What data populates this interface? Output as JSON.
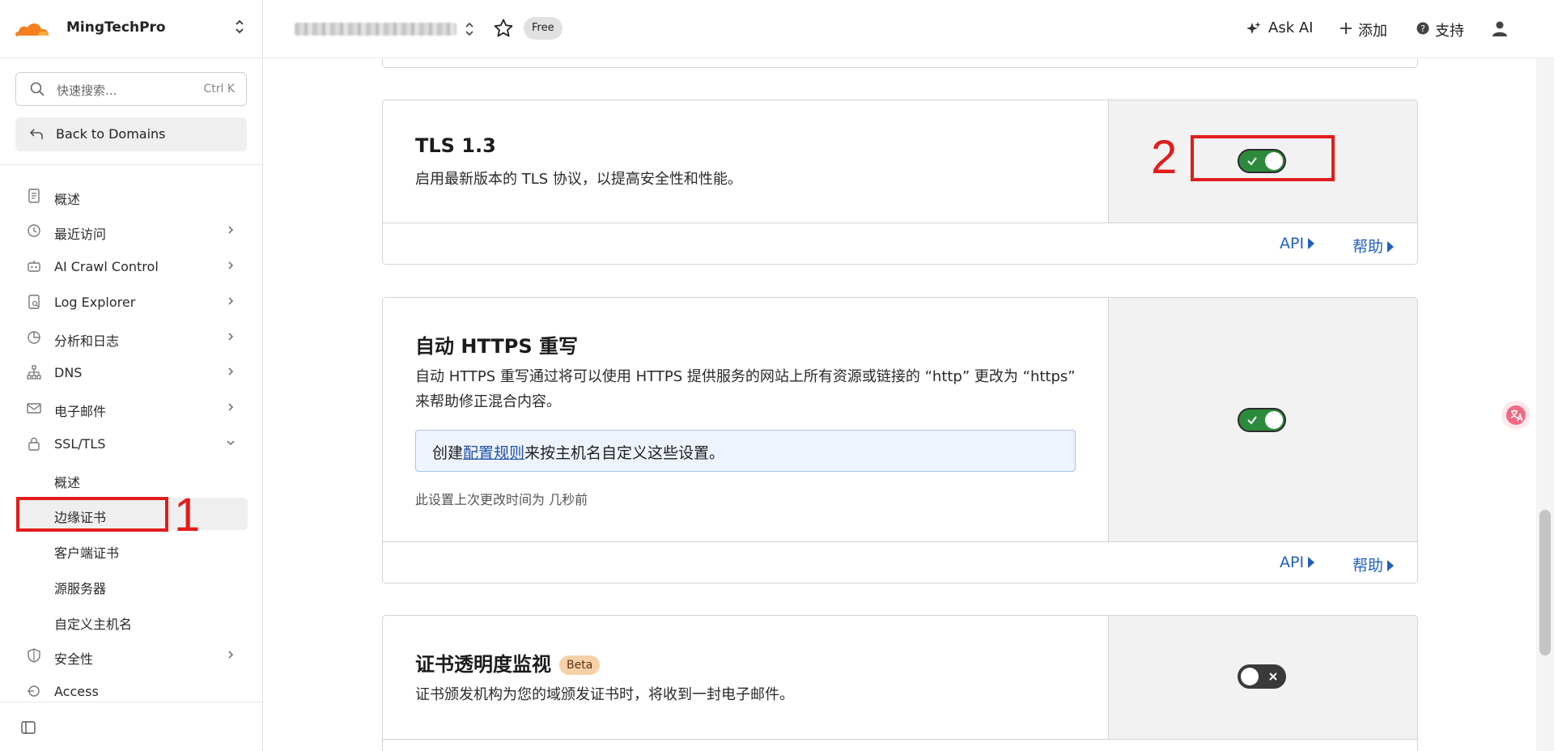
{
  "sidebar": {
    "account_name": "MingTechPro",
    "search": {
      "placeholder": "快速搜索...",
      "shortcut": "Ctrl K"
    },
    "back_label": "Back to Domains",
    "items": [
      {
        "label": "概述",
        "icon": "document-icon"
      },
      {
        "label": "最近访问",
        "icon": "history-icon"
      },
      {
        "label": "AI Crawl Control",
        "icon": "robot-icon"
      },
      {
        "label": "Log Explorer",
        "icon": "log-icon"
      },
      {
        "label": "分析和日志",
        "icon": "chart-pie-icon"
      },
      {
        "label": "DNS",
        "icon": "network-icon"
      },
      {
        "label": "电子邮件",
        "icon": "mail-icon"
      },
      {
        "label": "SSL/TLS",
        "icon": "lock-icon"
      },
      {
        "label": "安全性",
        "icon": "shield-icon"
      },
      {
        "label": "Access",
        "icon": "access-icon"
      }
    ],
    "ssl_sub_items": [
      "概述",
      "边缘证书",
      "客户端证书",
      "源服务器",
      "自定义主机名"
    ],
    "active_sub_item": "边缘证书"
  },
  "topbar": {
    "plan_badge": "Free",
    "ask_ai": "Ask AI",
    "add": "添加",
    "support": "支持"
  },
  "annotations": {
    "one": "1",
    "two": "2"
  },
  "cards": {
    "tls13": {
      "title": "TLS 1.3",
      "description": "启用最新版本的 TLS 协议，以提高安全性和性能。",
      "enabled": true,
      "api_label": "API",
      "help_label": "帮助"
    },
    "auto_https": {
      "title": "自动 HTTPS 重写",
      "description": "自动 HTTPS 重写通过将可以使用 HTTPS 提供服务的网站上所有资源或链接的 “http” 更改为 “https” 来帮助修正混合内容。",
      "info_prefix": "创建",
      "info_link": "配置规则",
      "info_suffix": "来按主机名自定义这些设置。",
      "last_changed": "此设置上次更改时间为 几秒前",
      "enabled": true,
      "api_label": "API",
      "help_label": "帮助"
    },
    "ct_monitor": {
      "title": "证书透明度监视",
      "badge": "Beta",
      "description": "证书颁发机构为您的域颁发证书时，将收到一封电子邮件。",
      "enabled": false
    }
  },
  "colors": {
    "accent": "#1f5fc4",
    "toggle_on": "#2c8a3c",
    "annotation": "#e31c1c",
    "cloudflare_orange": "#f38020"
  }
}
